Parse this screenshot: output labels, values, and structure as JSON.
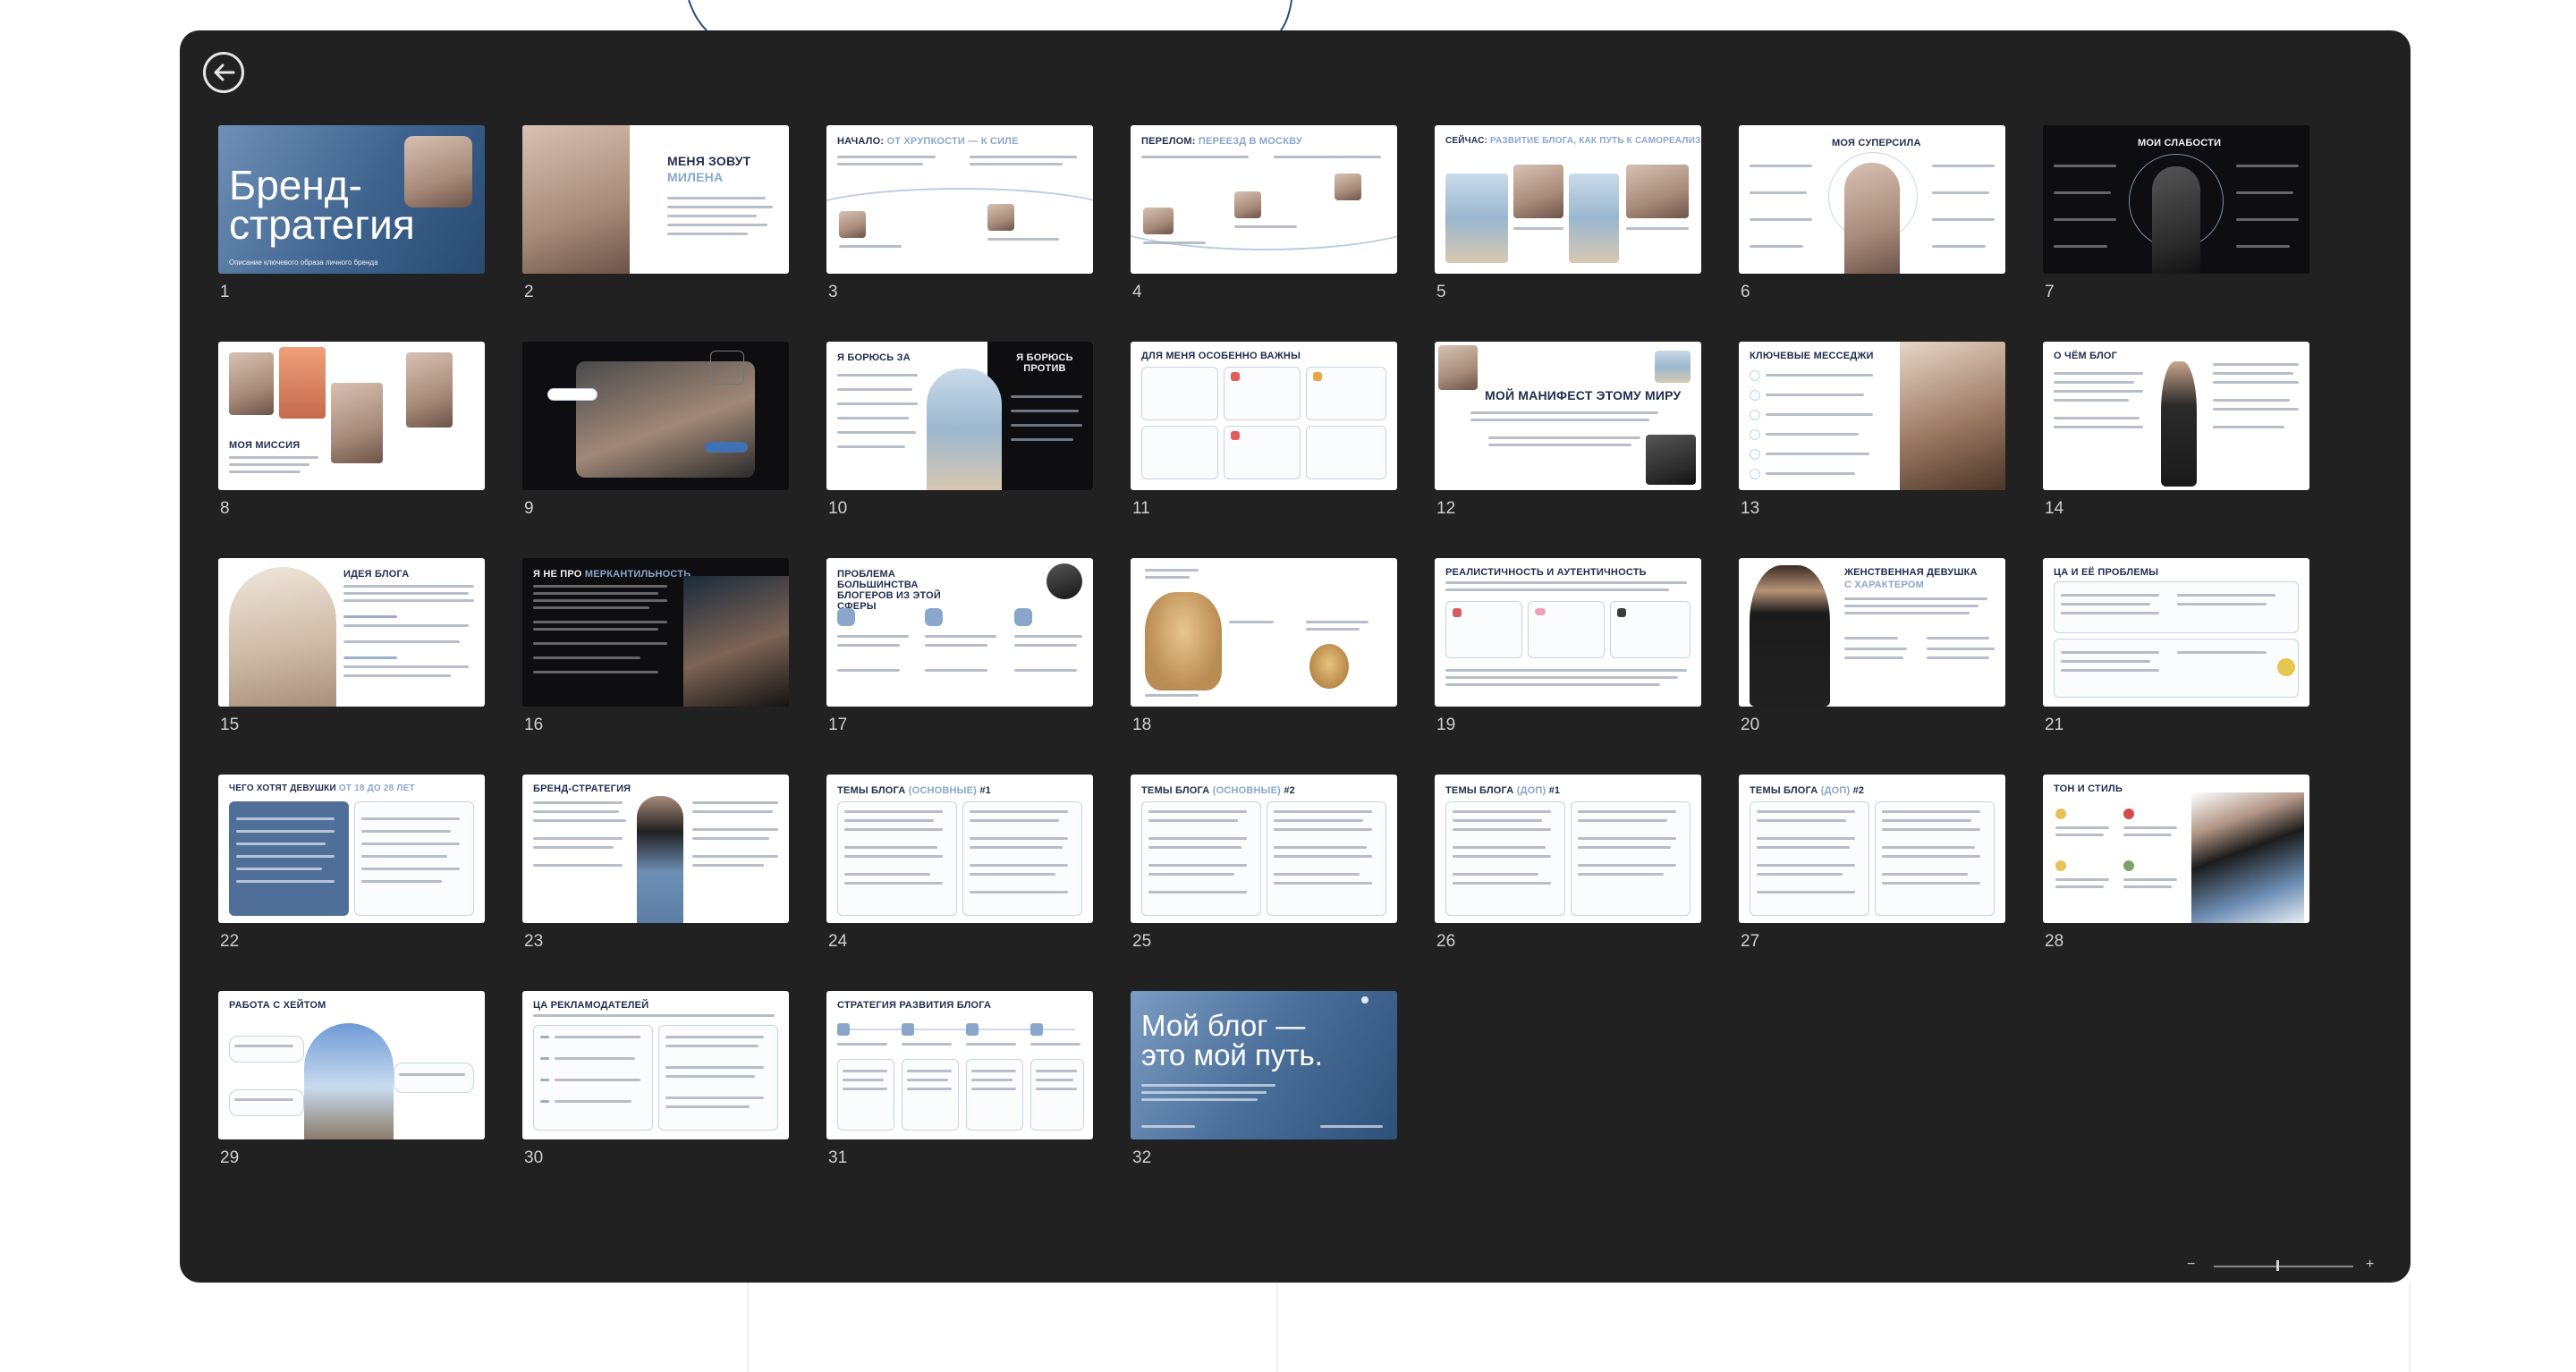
{
  "viewer": {
    "back_icon": "arrow-left-icon",
    "zoom_value_fraction": 0.45,
    "zoom_minus": "−",
    "zoom_plus": "+"
  },
  "slides": [
    {
      "n": "1",
      "title": "Бренд-\nстратегия",
      "subtitle": "Описание ключевого образа личного бренда"
    },
    {
      "n": "2",
      "title": "МЕНЯ ЗОВУТ",
      "accent": "МИЛЕНА"
    },
    {
      "n": "3",
      "title": "НАЧАЛО:",
      "accent": "ОТ ХРУПКОСТИ — К СИЛЕ"
    },
    {
      "n": "4",
      "title": "ПЕРЕЛОМ:",
      "accent": "ПЕРЕЕЗД В МОСКВУ"
    },
    {
      "n": "5",
      "title": "СЕЙЧАС:",
      "accent": "РАЗВИТИЕ БЛОГА, КАК ПУТЬ К САМОРЕАЛИЗАЦИИ"
    },
    {
      "n": "6",
      "title": "МОЯ СУПЕРСИЛА"
    },
    {
      "n": "7",
      "title": "МОИ СЛАБОСТИ"
    },
    {
      "n": "8",
      "title": "МОЯ МИССИЯ"
    },
    {
      "n": "9",
      "title": ""
    },
    {
      "n": "10",
      "title": "Я БОРЮСЬ ЗА",
      "title2": "Я БОРЮСЬ ПРОТИВ"
    },
    {
      "n": "11",
      "title": "ДЛЯ МЕНЯ ОСОБЕННО ВАЖНЫ"
    },
    {
      "n": "12",
      "title": "МОЙ МАНИФЕСТ ЭТОМУ МИРУ"
    },
    {
      "n": "13",
      "title": "КЛЮЧЕВЫЕ МЕССЕДЖИ"
    },
    {
      "n": "14",
      "title": "О ЧЁМ БЛОГ"
    },
    {
      "n": "15",
      "title": "ИДЕЯ БЛОГА"
    },
    {
      "n": "16",
      "title": "Я НЕ ПРО",
      "accent": "МЕРКАНТИЛЬНОСТЬ"
    },
    {
      "n": "17",
      "title": "ПРОБЛЕМА БОЛЬШИНСТВА БЛОГЕРОВ ИЗ ЭТОЙ СФЕРЫ"
    },
    {
      "n": "18",
      "title": ""
    },
    {
      "n": "19",
      "title": "РЕАЛИСТИЧНОСТЬ И АУТЕНТИЧНОСТЬ"
    },
    {
      "n": "20",
      "title": "ЖЕНСТВЕННАЯ ДЕВУШКА",
      "accent": "С ХАРАКТЕРОМ"
    },
    {
      "n": "21",
      "title": "ЦА И ЕЁ ПРОБЛЕМЫ"
    },
    {
      "n": "22",
      "title": "ЧЕГО ХОТЯТ ДЕВУШКИ",
      "accent": "ОТ 18 ДО 28 ЛЕТ"
    },
    {
      "n": "23",
      "title": "БРЕНД-СТРАТЕГИЯ"
    },
    {
      "n": "24",
      "title": "ТЕМЫ БЛОГА",
      "accent": "(ОСНОВНЫЕ)",
      "tail": "#1"
    },
    {
      "n": "25",
      "title": "ТЕМЫ БЛОГА",
      "accent": "(ОСНОВНЫЕ)",
      "tail": "#2"
    },
    {
      "n": "26",
      "title": "ТЕМЫ БЛОГА",
      "accent": "(ДОП)",
      "tail": "#1"
    },
    {
      "n": "27",
      "title": "ТЕМЫ БЛОГА",
      "accent": "(ДОП)",
      "tail": "#2"
    },
    {
      "n": "28",
      "title": "ТОН И СТИЛЬ"
    },
    {
      "n": "29",
      "title": "РАБОТА С ХЕЙТОМ"
    },
    {
      "n": "30",
      "title": "ЦА РЕКЛАМОДАТЕЛЕЙ"
    },
    {
      "n": "31",
      "title": "СТРАТЕГИЯ РАЗВИТИЯ БЛОГА"
    },
    {
      "n": "32",
      "title": "Мой блог —\nэто мой путь."
    }
  ]
}
